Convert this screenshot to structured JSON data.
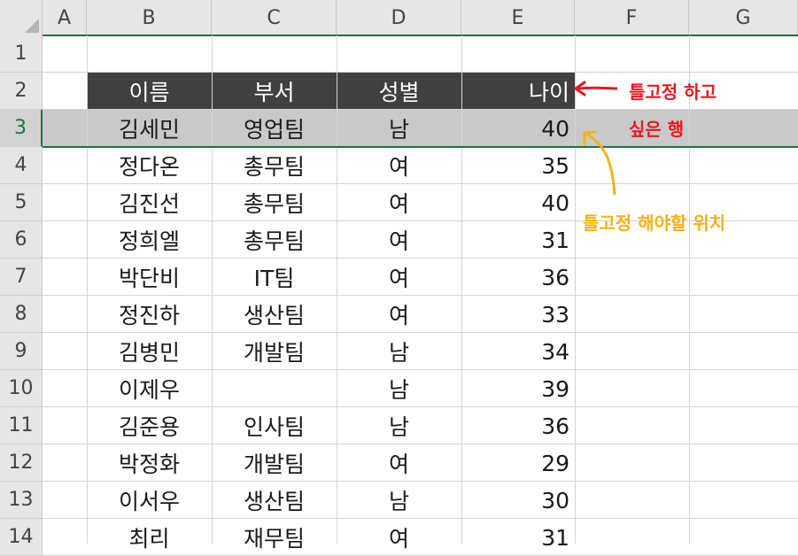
{
  "columns": [
    "A",
    "B",
    "C",
    "D",
    "E",
    "F",
    "G"
  ],
  "rows": [
    "1",
    "2",
    "3",
    "4",
    "5",
    "6",
    "7",
    "8",
    "9",
    "10",
    "11",
    "12",
    "13",
    "14"
  ],
  "header": {
    "name": "이름",
    "dept": "부서",
    "gender": "성별",
    "age": "나이"
  },
  "data_rows": [
    {
      "name": "김세민",
      "dept": "영업팀",
      "gender": "남",
      "age": "40"
    },
    {
      "name": "정다온",
      "dept": "총무팀",
      "gender": "여",
      "age": "35"
    },
    {
      "name": "김진선",
      "dept": "총무팀",
      "gender": "여",
      "age": "40"
    },
    {
      "name": "정희엘",
      "dept": "총무팀",
      "gender": "여",
      "age": "31"
    },
    {
      "name": "박단비",
      "dept": "IT팀",
      "gender": "여",
      "age": "36"
    },
    {
      "name": "정진하",
      "dept": "생산팀",
      "gender": "여",
      "age": "33"
    },
    {
      "name": "김병민",
      "dept": "개발팀",
      "gender": "남",
      "age": "34"
    },
    {
      "name": "이제우",
      "dept": "",
      "gender": "남",
      "age": "39"
    },
    {
      "name": "김준용",
      "dept": "인사팀",
      "gender": "남",
      "age": "36"
    },
    {
      "name": "박정화",
      "dept": "개발팀",
      "gender": "여",
      "age": "29"
    },
    {
      "name": "이서우",
      "dept": "생산팀",
      "gender": "남",
      "age": "30"
    },
    {
      "name": "최리",
      "dept": "재무팀",
      "gender": "여",
      "age": "31"
    }
  ],
  "annotations": {
    "red_line1": "틀고정 하고",
    "red_line2": "싶은 행",
    "yellow": "틀고정 해야할 위치"
  },
  "colors": {
    "header_fill": "#404040",
    "selected_row_fill": "#c9c9c9",
    "accent_green": "#1f7244",
    "red": "#e31b23",
    "yellow": "#f3b21b",
    "selected_row": "3"
  }
}
